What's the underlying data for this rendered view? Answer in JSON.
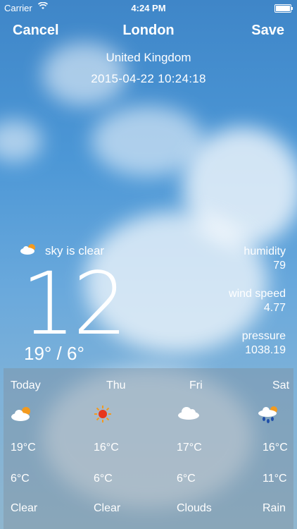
{
  "status": {
    "carrier": "Carrier",
    "time": "4:24 PM"
  },
  "nav": {
    "cancel": "Cancel",
    "title": "London",
    "save": "Save"
  },
  "location": {
    "country": "United Kingdom",
    "datetime": "2015-04-22 10:24:18"
  },
  "current": {
    "condition": "sky is clear",
    "condition_icon": "partly-cloudy-icon",
    "temperature": "12",
    "range": "19° / 6°"
  },
  "stats": [
    {
      "label": "humidity",
      "value": "79"
    },
    {
      "label": "wind speed",
      "value": "4.77"
    },
    {
      "label": "pressure",
      "value": "1038.19"
    }
  ],
  "forecast": [
    {
      "day": "Today",
      "icon": "partly-cloudy-icon",
      "high": "19°C",
      "low": "6°C",
      "desc": "Clear"
    },
    {
      "day": "Thu",
      "icon": "sun-icon",
      "high": "16°C",
      "low": "6°C",
      "desc": "Clear"
    },
    {
      "day": "Fri",
      "icon": "cloud-icon",
      "high": "17°C",
      "low": "6°C",
      "desc": "Clouds"
    },
    {
      "day": "Sat",
      "icon": "rain-icon",
      "high": "16°C",
      "low": "11°C",
      "desc": "Rain"
    }
  ]
}
